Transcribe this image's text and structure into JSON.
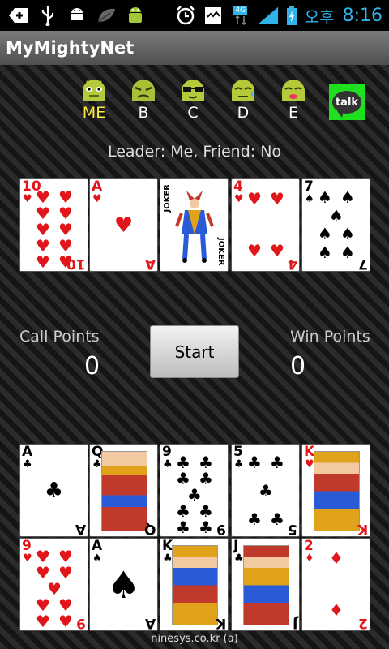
{
  "status_bar": {
    "ampm": "오후",
    "time": "8:16",
    "network": "4G"
  },
  "app": {
    "title": "MyMightyNet"
  },
  "players": [
    {
      "label": "ME",
      "color": "#ffeb3b",
      "mood": "neutral"
    },
    {
      "label": "B",
      "color": "#ffffff",
      "mood": "sad"
    },
    {
      "label": "C",
      "color": "#ffffff",
      "mood": "cool"
    },
    {
      "label": "D",
      "color": "#ffffff",
      "mood": "worried"
    },
    {
      "label": "E",
      "color": "#ffffff",
      "mood": "kiss"
    }
  ],
  "talk": {
    "label": "talk"
  },
  "info": {
    "leader_text": "Leader: Me, Friend: No"
  },
  "table_cards": [
    {
      "rank": "10",
      "suit": "♥",
      "color": "red"
    },
    {
      "rank": "A",
      "suit": "♥",
      "color": "red"
    },
    {
      "rank": "JOKER",
      "suit": "",
      "color": "black"
    },
    {
      "rank": "4",
      "suit": "♥",
      "color": "red"
    },
    {
      "rank": "7",
      "suit": "♠",
      "color": "black"
    }
  ],
  "scores": {
    "call_label": "Call Points",
    "call_value": "0",
    "win_label": "Win Points",
    "win_value": "0"
  },
  "start_button": {
    "label": "Start"
  },
  "hand_cards": [
    {
      "rank": "A",
      "suit": "♣",
      "color": "black"
    },
    {
      "rank": "Q",
      "suit": "♣",
      "color": "black"
    },
    {
      "rank": "9",
      "suit": "♣",
      "color": "black"
    },
    {
      "rank": "5",
      "suit": "♣",
      "color": "black"
    },
    {
      "rank": "K",
      "suit": "♥",
      "color": "red"
    },
    {
      "rank": "9",
      "suit": "♥",
      "color": "red"
    },
    {
      "rank": "A",
      "suit": "♠",
      "color": "black"
    },
    {
      "rank": "K",
      "suit": "♣",
      "color": "black"
    },
    {
      "rank": "J",
      "suit": "♣",
      "color": "black"
    },
    {
      "rank": "2",
      "suit": "♦",
      "color": "red"
    }
  ],
  "footer": {
    "text": "ninesys.co.kr (a)"
  }
}
